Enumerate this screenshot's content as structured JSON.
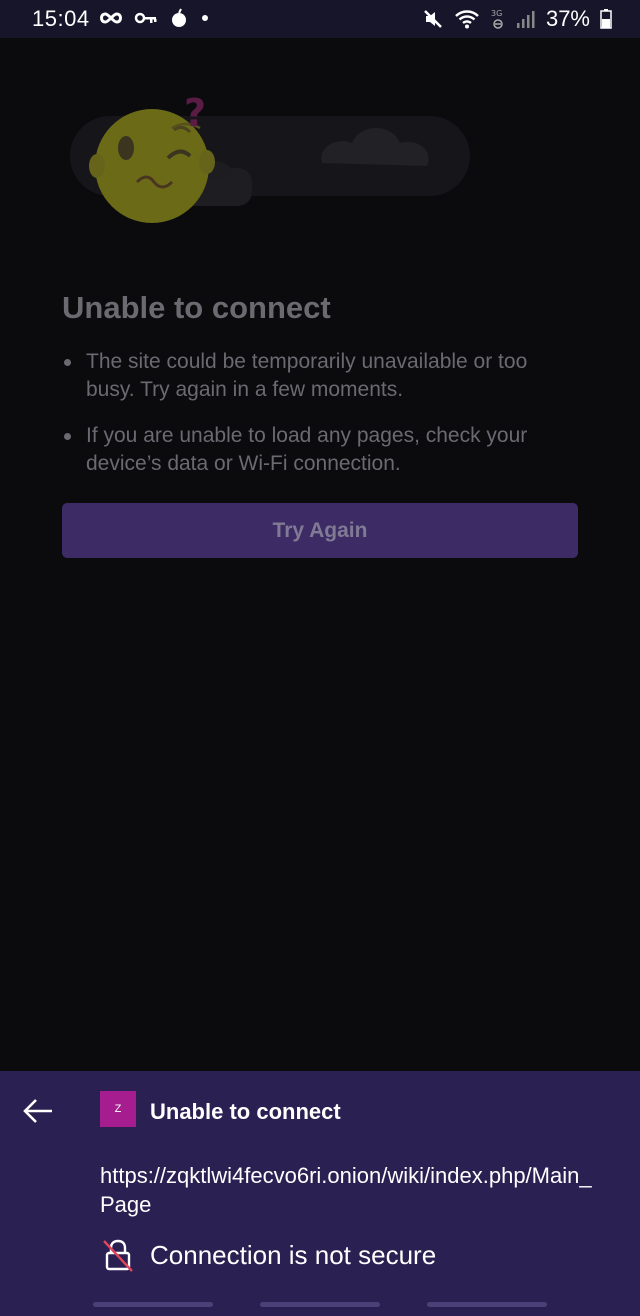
{
  "status_bar": {
    "time": "15:04",
    "battery": "37%",
    "left_icons": [
      "infinity-icon",
      "key-icon",
      "bomb-icon",
      "dot-icon"
    ],
    "right_icons": [
      "mute-icon",
      "wifi-icon",
      "network-3g-icon",
      "signal-icon",
      "battery-icon"
    ]
  },
  "error_page": {
    "title": "Unable to connect",
    "bullets": [
      "The site could be temporarily unavailable or too busy. Try again in a few moments.",
      "If you are unable to load any pages, check your device’s data or Wi-Fi connection."
    ],
    "try_again_label": "Try Again"
  },
  "sheet": {
    "favicon_letter": "Z",
    "title": "Unable to connect",
    "url": "https://zqktlwi4fecvo6ri.onion/wiki/index.php/Main_Page",
    "security_text": "Connection is not secure"
  },
  "colors": {
    "sheet_bg": "#2a2052",
    "button_bg": "#3c2b64",
    "favicon_bg": "#a51d8e"
  }
}
